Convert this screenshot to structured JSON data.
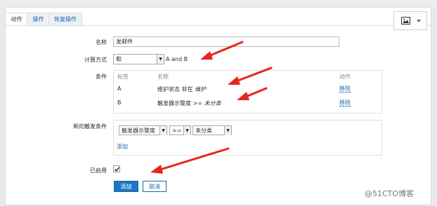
{
  "tabs": [
    {
      "label": "动作",
      "active": true
    },
    {
      "label": "操作",
      "active": false
    },
    {
      "label": "恢复操作",
      "active": false
    }
  ],
  "form": {
    "name_label": "名称",
    "name_value": "发邮件",
    "calc_label": "计算方式",
    "calc_value": "和",
    "calc_expr": "A and B",
    "conditions_label": "条件",
    "conditions": {
      "headers": [
        "标签",
        "名称",
        "动作"
      ],
      "rows": [
        {
          "tag": "A",
          "name_prefix": "维护状态 非在 ",
          "name_em": "维护",
          "action": "移除"
        },
        {
          "tag": "B",
          "name_prefix": "触发器示警度 >= ",
          "name_em": "未分类",
          "action": "移除"
        }
      ]
    },
    "new_trigger_label": "新的触发条件",
    "new_trigger": {
      "field": "触发器示警度",
      "operator": ">=",
      "value": "未分类",
      "add_link": "添加"
    },
    "enabled_label": "已启用",
    "enabled": true,
    "add_button": "添加",
    "cancel_button": "取消"
  },
  "watermark": "@51CTO博客",
  "colors": {
    "link": "#1f65a8",
    "primary": "#1f76c2",
    "arrow": "#e8241d"
  }
}
